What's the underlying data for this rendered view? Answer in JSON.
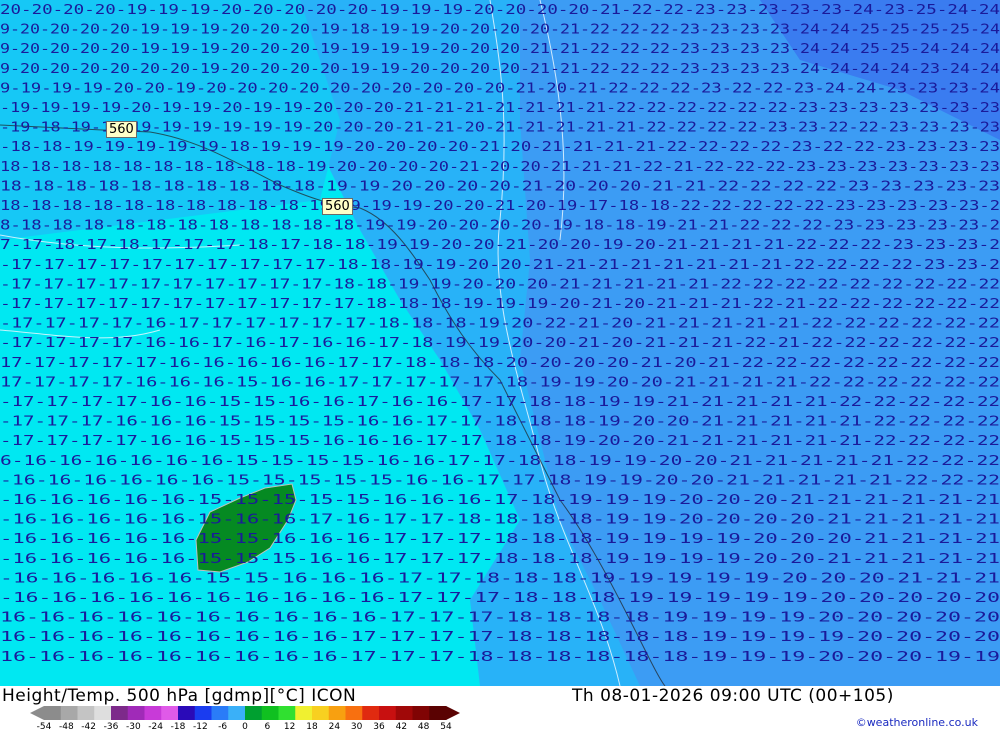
{
  "map": {
    "contour_labels": [
      "560",
      "560"
    ],
    "temperature_rows": [
      "20-20-20-20-19-19-19-20-20-20-20-20-19-19-19-20-20-20-20-21-22-22-23-23-23-23-23-24-23-25-24-24",
      "9-20-20-20-20-19-19-19-20-20-20-19-18-19-19-20-20-20-20-21-22-22-22-23-23-23-23-24-24-25-25-25-25-24",
      "9-20-20-20-20-19-19-19-20-20-20-19-19-19-19-20-20-20-21-21-22-22-22-23-23-23-23-24-24-25-25-24-24-24",
      "9-20-20-20-20-20-20-19-20-20-20-20-19-19-20-20-20-20-21-21-22-22-22-23-23-23-23-24-24-24-24-23-24-24",
      "9-19-19-19-20-20-19-20-20-20-20-20-20-20-20-20-20-21-20-21-22-22-22-23-22-22-23-24-24-23-23-23-24",
      "-19-19-19-19-20-19-19-20-19-19-20-20-20-21-21-21-21-21-21-21-22-22-22-22-22-22-23-23-23-23-23-23-23",
      "-19-18-19-19-19-19-19-19-19-19-20-20-20-21-21-20-21-21-21-21-21-22-22-22-22-23-23-22-22-23-23-23-23",
      "-18-18-19-19-19-19-19-18-19-19-19-20-20-20-20-21-20-21-21-21-21-22-22-22-22-23-22-22-23-23-23-23",
      "18-18-18-18-18-18-18-18-18-18-19-20-20-20-20-21-20-20-21-21-21-22-21-22-22-22-23-23-23-23-23-23-23",
      "18-18-18-18-18-18-18-18-18-18-19-19-20-20-20-20-21-20-20-20-21-21-22-22-22-22-23-23-23-23-23",
      "18-18-18-18-18-18-18-18-18-18-19-19-19-19-20-20-21-20-19-17-18-18-22-22-22-22-22-23-23-23-23-23-2",
      "8-18-18-18-18-18-18-18-18-18-18-18-19-19-20-20-20-20-19-18-18-19-21-21-22-22-22-23-23-23-23-23-2",
      "7-17-18-17-18-17-17-17-18-17-18-18-19-19-20-20-21-20-20-19-20-21-21-21-21-22-22-22-23-23-23-2",
      "-17-17-17-17-17-17-17-17-17-17-18-18-19-19-20-20-21-21-21-21-21-21-21-21-22-22-22-22-23-23-2",
      "-17-17-17-17-17-17-17-17-17-17-18-18-19-19-20-20-20-21-21-21-21-21-22-22-22-22-22-22-22-22-22",
      "-17-17-17-17-17-17-17-17-17-17-17-18-18-18-19-19-19-20-21-20-21-21-21-22-21-22-22-22-22-22-22",
      "-17-17-17-17-16-17-17-17-17-17-17-18-18-18-19-20-22-21-20-21-21-21-21-21-22-22-22-22-22-22",
      "-17-17-17-17-16-16-17-16-17-16-16-17-18-19-19-20-20-21-20-21-21-21-22-21-22-22-22-22-22-22",
      "17-17-17-17-17-16-16-16-16-16-17-17-18-18-18-20-20-20-20-21-20-21-22-22-22-22-22-22-22-22",
      "17-17-17-17-16-16-16-15-16-16-17-17-17-17-17-18-19-19-20-20-21-21-21-21-22-22-22-22-22-22",
      "-17-17-17-17-16-16-15-15-16-16-17-16-16-17-17-18-18-19-19-21-21-21-21-21-22-22-22-22-22",
      "-17-17-17-16-16-16-15-15-15-15-16-16-17-17-18-18-18-19-20-20-21-21-21-21-21-22-22-22-22",
      "-17-17-17-17-16-16-15-15-15-16-16-16-17-17-18-18-19-20-20-21-21-21-21-21-21-22-22-22-22",
      "6-16-16-16-16-16-16-15-15-15-15-16-16-17-17-18-18-19-19-20-20-21-21-21-21-21-22-22-22",
      "-16-16-16-16-16-16-15-15-15-15-15-16-16-17-17-18-19-19-20-20-21-21-21-21-21-22-22-22",
      "-16-16-16-16-16-15-15-15-15-15-16-16-16-17-18-19-19-19-20-20-20-21-21-21-21-21-21",
      "-16-16-16-16-16-15-16-16-17-16-17-17-18-18-18-18-19-19-20-20-20-20-21-21-21-21-21",
      "-16-16-16-16-16-15-15-16-16-16-17-17-17-18-18-18-19-19-19-19-20-20-20-21-21-21-21",
      "-16-16-16-16-16-15-15-15-16-16-17-17-17-18-18-18-19-19-19-19-20-20-21-21-21-21-21",
      "-16-16-16-16-16-15-15-16-16-16-17-17-18-18-18-19-19-19-19-19-20-20-20-21-21-21",
      "-16-16-16-16-16-16-16-16-16-16-17-17-17-18-18-18-19-19-19-19-19-20-20-20-20-20",
      "16-16-16-16-16-16-16-16-16-16-17-17-17-18-18-18-18-19-19-19-19-20-20-20-20-20",
      "16-16-16-16-16-16-16-16-16-17-17-17-17-18-18-18-18-18-19-19-19-19-20-20-20-20",
      "16-16-16-16-16-16-16-16-16-17-17-17-18-18-18-18-18-18-19-19-19-20-20-20-19-19"
    ]
  },
  "footer": {
    "title_left": "Height/Temp. 500 hPa [gdmp][°C] ICON",
    "title_right": "Th 08-01-2026 09:00 UTC (00+105)",
    "copyright": "©weatheronline.co.uk",
    "scale_labels": [
      "-54",
      "-48",
      "-42",
      "-36",
      "-30",
      "-24",
      "-18",
      "-12",
      "-6",
      "0",
      "6",
      "12",
      "18",
      "24",
      "30",
      "36",
      "42",
      "48",
      "54"
    ],
    "scale_colors": [
      "#8c8c8c",
      "#a8a8a8",
      "#c4c4c4",
      "#dedede",
      "#7d2a8a",
      "#a02ab8",
      "#c83ad8",
      "#e05ae8",
      "#2a0ab8",
      "#1a3cf0",
      "#2a7cf8",
      "#3ab0f8",
      "#00a030",
      "#10c020",
      "#30e030",
      "#f0f030",
      "#f8d020",
      "#f8a010",
      "#f87010",
      "#e02a10",
      "#c81010",
      "#a00808",
      "#800404",
      "#5a0202"
    ]
  }
}
